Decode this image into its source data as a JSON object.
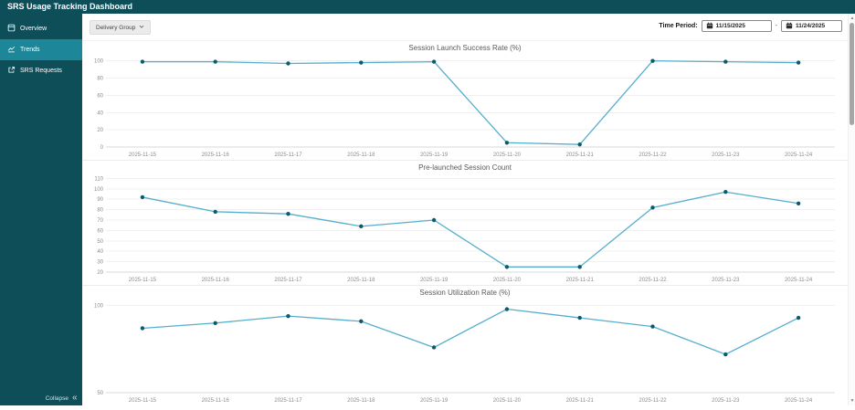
{
  "header": {
    "title": "SRS Usage Tracking Dashboard"
  },
  "sidebar": {
    "items": [
      {
        "label": "Overview",
        "icon": "overview-icon",
        "active": false
      },
      {
        "label": "Trends",
        "icon": "trends-icon",
        "active": true
      },
      {
        "label": "SRS Requests",
        "icon": "external-link-icon",
        "active": false
      }
    ],
    "collapse_label": "Collapse"
  },
  "controls": {
    "delivery_group_label": "Delivery Group",
    "time_period_label": "Time Period:",
    "date_start": "11/15/2025",
    "date_end": "11/24/2025",
    "range_separator": "-"
  },
  "colors": {
    "brand_teal": "#0d4e59",
    "active_teal": "#1d8799",
    "line": "#55aecd",
    "point": "#0c5a6e",
    "grid": "#f0f0f0",
    "axis": "#d8d8d8",
    "tick_text": "#8c8c8c",
    "title_text": "#5a5a5a"
  },
  "chart_data": [
    {
      "type": "line",
      "title": "Session Launch Success Rate (%)",
      "categories": [
        "2025-11-15",
        "2025-11-16",
        "2025-11-17",
        "2025-11-18",
        "2025-11-19",
        "2025-11-20",
        "2025-11-21",
        "2025-11-22",
        "2025-11-23",
        "2025-11-24"
      ],
      "values": [
        99,
        99,
        97,
        98,
        99,
        5,
        3,
        100,
        99,
        98
      ],
      "yticks": [
        100,
        80,
        60,
        40,
        20,
        0
      ],
      "ylim": [
        0,
        106
      ],
      "xlabel": "",
      "ylabel": "",
      "grid": true,
      "legend": "none"
    },
    {
      "type": "line",
      "title": "Pre-launched Session Count",
      "categories": [
        "2025-11-15",
        "2025-11-16",
        "2025-11-17",
        "2025-11-18",
        "2025-11-19",
        "2025-11-20",
        "2025-11-21",
        "2025-11-22",
        "2025-11-23",
        "2025-11-24"
      ],
      "values": [
        92,
        78,
        76,
        64,
        70,
        25,
        25,
        82,
        97,
        86
      ],
      "yticks": [
        110,
        100,
        90,
        80,
        70,
        60,
        50,
        40,
        30,
        20
      ],
      "ylim": [
        20,
        113
      ],
      "xlabel": "",
      "ylabel": "",
      "grid": true,
      "legend": "none"
    },
    {
      "type": "line",
      "title": "Session Utilization Rate (%)",
      "categories": [
        "2025-11-15",
        "2025-11-16",
        "2025-11-17",
        "2025-11-18",
        "2025-11-19",
        "2025-11-20",
        "2025-11-21",
        "2025-11-22",
        "2025-11-23",
        "2025-11-24"
      ],
      "values": [
        87,
        90,
        94,
        91,
        76,
        98,
        93,
        88,
        72,
        93
      ],
      "yticks": [
        100,
        50
      ],
      "ylim": [
        50,
        103
      ],
      "xlabel": "",
      "ylabel": "",
      "grid": true,
      "legend": "none"
    }
  ],
  "scrollbar": {
    "up_glyph": "▲",
    "down_glyph": "▼"
  }
}
